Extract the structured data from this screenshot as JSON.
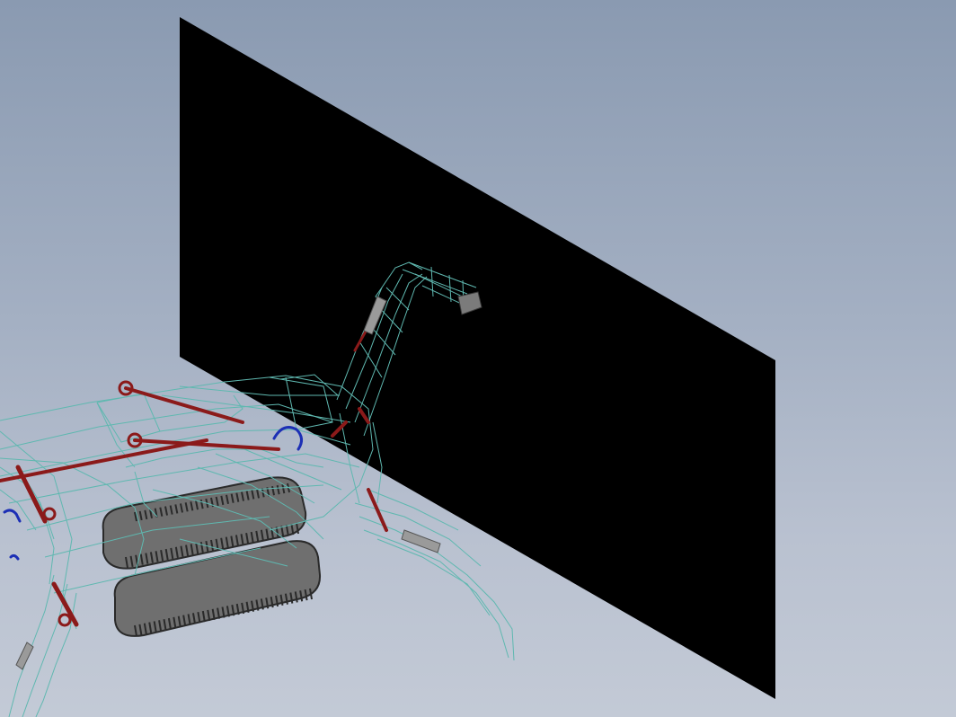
{
  "viewport": {
    "background_top": "#8a9ab1",
    "background_bottom": "#c3cad6"
  },
  "scene": {
    "panel_color": "#000000",
    "wireframe_color": "#5fb8b0",
    "cylinder_color": "#8b1a1a",
    "hose_color": "#1c2fb5",
    "track_color": "#6e6e6e",
    "track_link_color": "#2a2a2a"
  }
}
